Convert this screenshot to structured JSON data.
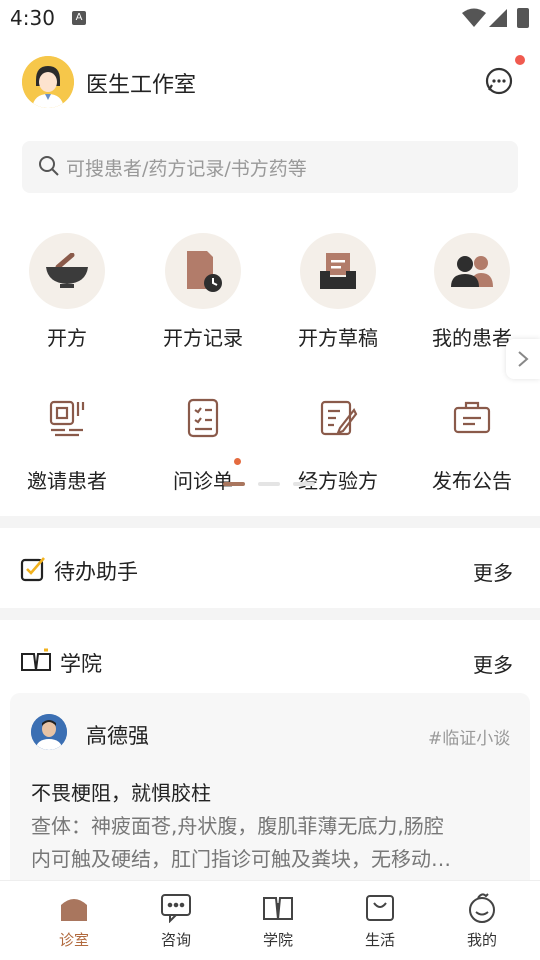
{
  "status_bar": {
    "time": "4:30",
    "a_label": "A"
  },
  "header": {
    "title": "医生工作室"
  },
  "search": {
    "placeholder": "可搜患者/药方记录/书方药等"
  },
  "grid_row1": [
    {
      "label": "开方",
      "icon": "mortar-icon"
    },
    {
      "label": "开方记录",
      "icon": "prescription-record-icon"
    },
    {
      "label": "开方草稿",
      "icon": "draft-box-icon"
    },
    {
      "label": "我的患者",
      "icon": "patients-icon"
    }
  ],
  "grid_row2": [
    {
      "label": "邀请患者",
      "icon": "qr-invite-icon"
    },
    {
      "label": "问诊单",
      "icon": "checklist-icon"
    },
    {
      "label": "经方验方",
      "icon": "edit-doc-icon"
    },
    {
      "label": "发布公告",
      "icon": "announcement-icon"
    }
  ],
  "todo": {
    "title": "待办助手",
    "more": "更多"
  },
  "academy": {
    "title": "学院",
    "more": "更多",
    "card": {
      "author": "高德强",
      "tag": "#临证小谈",
      "title": "不畏梗阻，就惧胶柱",
      "body_line1": "查体：神疲面苍,舟状腹，腹肌菲薄无底力,肠腔",
      "body_line2": "内可触及硬结，肛门指诊可触及粪块，无移动…"
    }
  },
  "tabs": [
    {
      "label": "诊室",
      "icon": "clinic-icon",
      "active": true
    },
    {
      "label": "咨询",
      "icon": "chat-icon",
      "active": false
    },
    {
      "label": "学院",
      "icon": "book-icon",
      "active": false
    },
    {
      "label": "生活",
      "icon": "life-bag-icon",
      "active": false
    },
    {
      "label": "我的",
      "icon": "profile-icon",
      "active": false
    }
  ],
  "colors": {
    "accent": "#b16a3e",
    "badge": "#f05a4f",
    "icon_brown": "#8a5a4a"
  }
}
